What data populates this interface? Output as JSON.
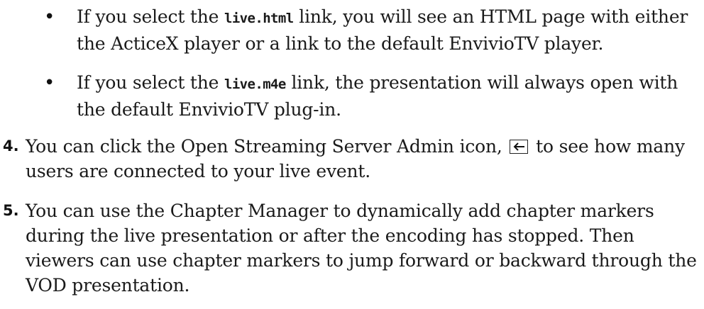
{
  "bullets": [
    {
      "before": "If you select the ",
      "code": "live.html",
      "after": " link, you will see an HTML page with either the ActiceX player or a link to the default EnvivioTV player."
    },
    {
      "before": "If you select the ",
      "code": "live.m4e",
      "after": " link, the presentation will always open with the default EnvivioTV plug-in."
    }
  ],
  "steps": [
    {
      "number": "4.",
      "before_icon": "You can click the Open Streaming Server Admin icon, ",
      "icon": "back-arrow-icon",
      "after_icon": " to see how many users are connected to your live event."
    },
    {
      "number": "5.",
      "text": "You can use the Chapter Manager to dynamically add chapter markers during the live presentation or after the encoding has stopped. Then viewers can use chapter markers to jump forward or backward through the VOD presentation."
    }
  ]
}
